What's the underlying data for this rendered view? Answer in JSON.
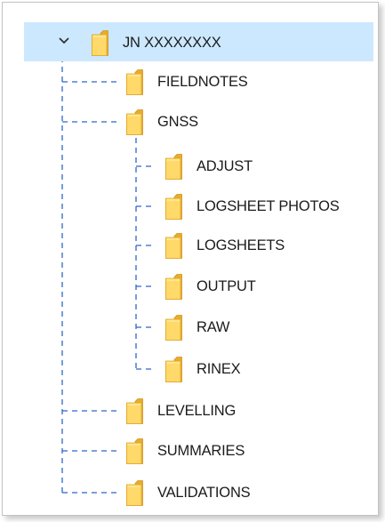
{
  "colors": {
    "selection": "#cce8ff",
    "tree_line": "#2e66c7",
    "folder_front": "#ffd969",
    "folder_back": "#e8ac2c",
    "text": "#1b1b1b"
  },
  "tree": {
    "root": {
      "label": "JN XXXXXXXX",
      "icon": "folder-icon",
      "expanded": true,
      "selected": true
    },
    "children": [
      {
        "label": "FIELDNOTES",
        "icon": "folder-icon"
      },
      {
        "label": "GNSS",
        "icon": "folder-icon",
        "expanded": true
      },
      {
        "label": "ADJUST",
        "icon": "folder-icon"
      },
      {
        "label": "LOGSHEET PHOTOS",
        "icon": "folder-icon"
      },
      {
        "label": "LOGSHEETS",
        "icon": "folder-icon"
      },
      {
        "label": "OUTPUT",
        "icon": "folder-icon"
      },
      {
        "label": "RAW",
        "icon": "folder-icon"
      },
      {
        "label": "RINEX",
        "icon": "folder-icon"
      },
      {
        "label": "LEVELLING",
        "icon": "folder-icon"
      },
      {
        "label": "SUMMARIES",
        "icon": "folder-icon"
      },
      {
        "label": "VALIDATIONS",
        "icon": "folder-icon"
      }
    ]
  }
}
